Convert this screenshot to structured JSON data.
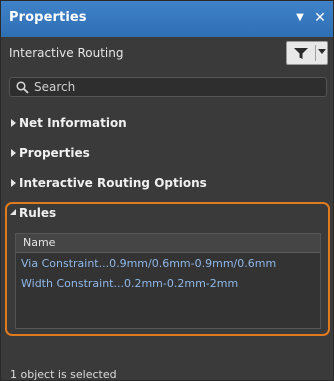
{
  "panel": {
    "title": "Properties",
    "icons": {
      "pin": "dropdown-triangle-icon",
      "close": "close-icon"
    }
  },
  "header": {
    "label": "Interactive Routing",
    "filter_icon": "filter-funnel-icon"
  },
  "search": {
    "placeholder": "Search",
    "value": ""
  },
  "sections": {
    "net_information": "Net Information",
    "properties": "Properties",
    "interactive_routing_options": "Interactive Routing Options",
    "rules": "Rules"
  },
  "rules_table": {
    "columns": [
      "Name"
    ],
    "rows": [
      "Via Constraint...0.9mm/0.6mm-0.9mm/0.6mm",
      "Width Constraint...0.2mm-0.2mm-2mm"
    ]
  },
  "status": "1 object is selected",
  "colors": {
    "titlebar": "#2f6fb4",
    "highlight": "#e07a1f",
    "link_text": "#8fb8e8",
    "panel_bg": "#3a3a3a"
  }
}
